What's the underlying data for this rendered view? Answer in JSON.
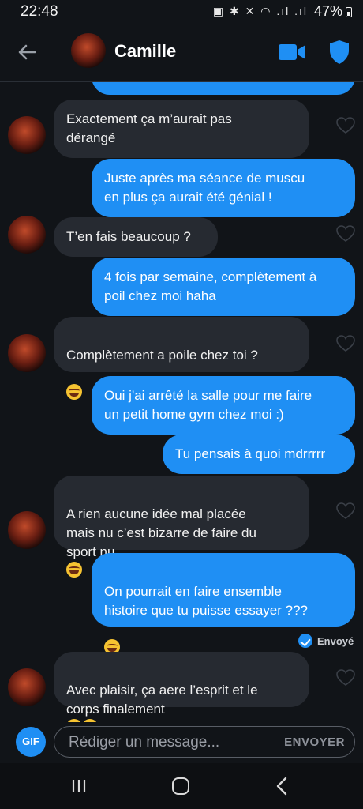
{
  "status_bar": {
    "time": "22:48",
    "battery": "47%",
    "icons": "▣ ✱ ✕ ◠ .ıl .ıl"
  },
  "header": {
    "contact_name": "Camille"
  },
  "messages": [
    {
      "dir": "in",
      "text": "Exactement ça m’aurait pas\ndérangé"
    },
    {
      "dir": "out",
      "text": "Juste après ma séance de muscu\nen plus ça aurait été génial !"
    },
    {
      "dir": "in",
      "text": "T’en fais beaucoup ?"
    },
    {
      "dir": "out",
      "text": "4 fois par semaine, complètement à\npoil chez moi haha"
    },
    {
      "dir": "in",
      "text": "Complètement a poile chez toi ?"
    },
    {
      "dir": "out",
      "text": "Oui j'ai arrêté la salle pour me faire\nun petit home gym chez moi :)"
    },
    {
      "dir": "out",
      "text": "Tu pensais à quoi mdrrrrr"
    },
    {
      "dir": "in",
      "text": "A rien aucune idée mal placée\nmais nu c’est bizarre de faire du\nsport nu"
    },
    {
      "dir": "out",
      "text": "On pourrait en faire ensemble\nhistoire que tu puisse essayer ???"
    },
    {
      "dir": "in",
      "text": "Avec plaisir, ça aere l’esprit et le\ncorps finalement"
    }
  ],
  "sent_status": "Envoyé",
  "input": {
    "gif_label": "GIF",
    "placeholder": "Rédiger un message...",
    "send_label": "ENVOYER"
  },
  "colors": {
    "outgoing": "#1f8ff4",
    "incoming": "#262a31",
    "background": "#111418"
  }
}
